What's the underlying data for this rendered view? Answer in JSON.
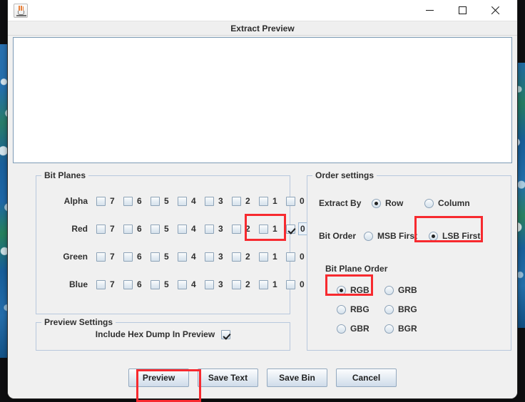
{
  "window": {
    "app_icon": "java-coffee-cup-icon",
    "minimize_label": "—",
    "maximize_label": "□",
    "close_label": "✕",
    "caption": "Extract Preview"
  },
  "preview": {
    "text": ""
  },
  "bit_planes": {
    "title": "Bit Planes",
    "bits": [
      "7",
      "6",
      "5",
      "4",
      "3",
      "2",
      "1",
      "0"
    ],
    "rows": [
      {
        "label": "Alpha",
        "checked": [
          false,
          false,
          false,
          false,
          false,
          false,
          false,
          false
        ]
      },
      {
        "label": "Red",
        "checked": [
          false,
          false,
          false,
          false,
          false,
          false,
          false,
          true
        ]
      },
      {
        "label": "Green",
        "checked": [
          false,
          false,
          false,
          false,
          false,
          false,
          false,
          false
        ]
      },
      {
        "label": "Blue",
        "checked": [
          false,
          false,
          false,
          false,
          false,
          false,
          false,
          false
        ]
      }
    ],
    "focused_cell": {
      "row": "Red",
      "bit": "0"
    }
  },
  "preview_settings": {
    "title": "Preview Settings",
    "include_hex_dump_label": "Include Hex Dump In Preview",
    "include_hex_dump_checked": true
  },
  "order_settings": {
    "title": "Order settings",
    "extract_by_label": "Extract By",
    "extract_by_options": [
      "Row",
      "Column"
    ],
    "extract_by_selected": "Row",
    "bit_order_label": "Bit Order",
    "bit_order_options": [
      "MSB First",
      "LSB First"
    ],
    "bit_order_selected": "LSB First",
    "bit_plane_order_label": "Bit Plane Order",
    "bit_plane_order_options": [
      "RGB",
      "GRB",
      "RBG",
      "BRG",
      "GBR",
      "BGR"
    ],
    "bit_plane_order_selected": "RGB"
  },
  "buttons": [
    {
      "label": "Preview"
    },
    {
      "label": "Save Text"
    },
    {
      "label": "Save Bin"
    },
    {
      "label": "Cancel"
    }
  ],
  "highlights": {
    "color": "#f72a2f",
    "targets": [
      "red-bit-0-checkbox",
      "lsb-first-radio",
      "rgb-radio",
      "preview-button"
    ]
  }
}
